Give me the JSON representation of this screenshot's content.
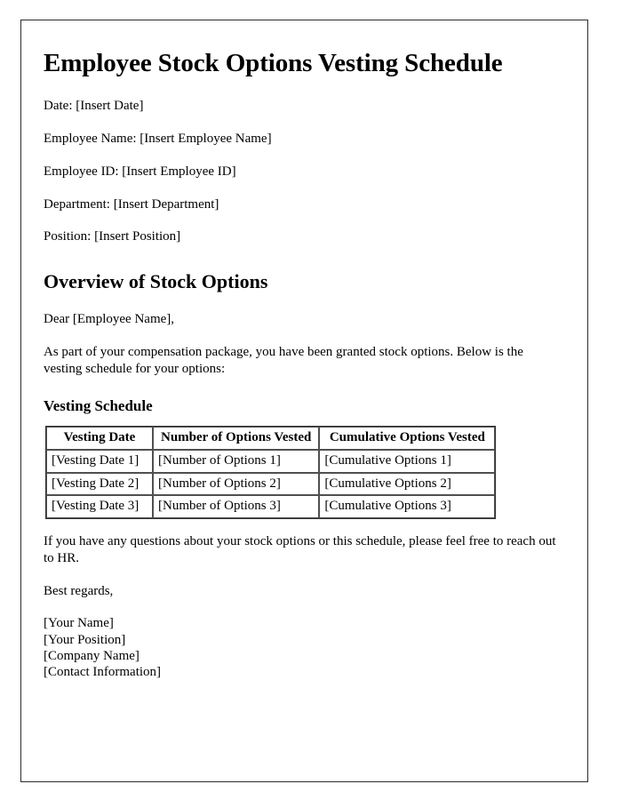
{
  "document": {
    "title": "Employee Stock Options Vesting Schedule",
    "meta_lines": [
      "Date: [Insert Date]",
      "Employee Name: [Insert Employee Name]",
      "Employee ID: [Insert Employee ID]",
      "Department: [Insert Department]",
      "Position: [Insert Position]"
    ],
    "overview": {
      "heading": "Overview of Stock Options",
      "salutation": "Dear [Employee Name],",
      "paragraph": "As part of your compensation package, you have been granted stock options. Below is the vesting schedule for your options:"
    },
    "vesting": {
      "heading": "Vesting Schedule",
      "table": {
        "headers": [
          "Vesting Date",
          "Number of Options Vested",
          "Cumulative Options Vested"
        ],
        "rows": [
          [
            "[Vesting Date 1]",
            "[Number of Options 1]",
            "[Cumulative Options 1]"
          ],
          [
            "[Vesting Date 2]",
            "[Number of Options 2]",
            "[Cumulative Options 2]"
          ],
          [
            "[Vesting Date 3]",
            "[Number of Options 3]",
            "[Cumulative Options 3]"
          ]
        ]
      }
    },
    "closing": {
      "paragraph": "If you have any questions about your stock options or this schedule, please feel free to reach out to HR.",
      "regards": "Best regards,",
      "signature_lines": [
        "[Your Name]",
        "[Your Position]",
        "[Company Name]",
        "[Contact Information]"
      ]
    }
  }
}
